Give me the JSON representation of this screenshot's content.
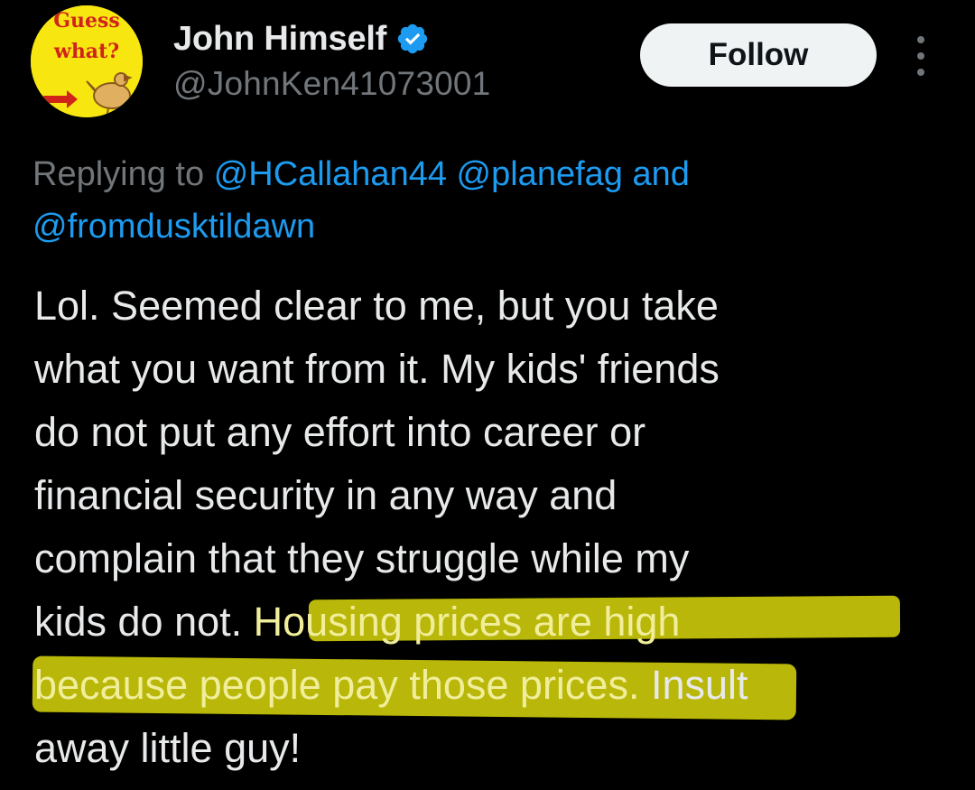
{
  "tweet": {
    "author": {
      "display_name": "John Himself",
      "handle": "@JohnKen41073001",
      "verified_icon": "verified-badge-icon",
      "avatar_text_top": "Guess",
      "avatar_text_bottom": "what?"
    },
    "follow_label": "Follow",
    "more_icon": "more-options-icon",
    "reply_context": {
      "prefix": "Replying to",
      "mentions": [
        "@HCallahan44",
        "@planefag",
        "@fromdusktildawn"
      ],
      "conjunction": "and"
    },
    "body": {
      "lines": [
        "Lol. Seemed clear to me, but you take",
        "what you want from it. My kids' friends",
        "do not put any effort into career or",
        "financial security in any way and",
        "complain that they struggle while my"
      ],
      "line6_plain": "kids do not. ",
      "line6_highlight": "Housing prices are high",
      "line7_highlight": "because people pay those prices.",
      "line7_plain": " Insult",
      "line8": "away little guy!"
    },
    "colors": {
      "background": "#000000",
      "text": "#e7e9ea",
      "secondary": "#71767b",
      "link": "#1d9bf0",
      "highlight": "#c9c70a"
    }
  }
}
